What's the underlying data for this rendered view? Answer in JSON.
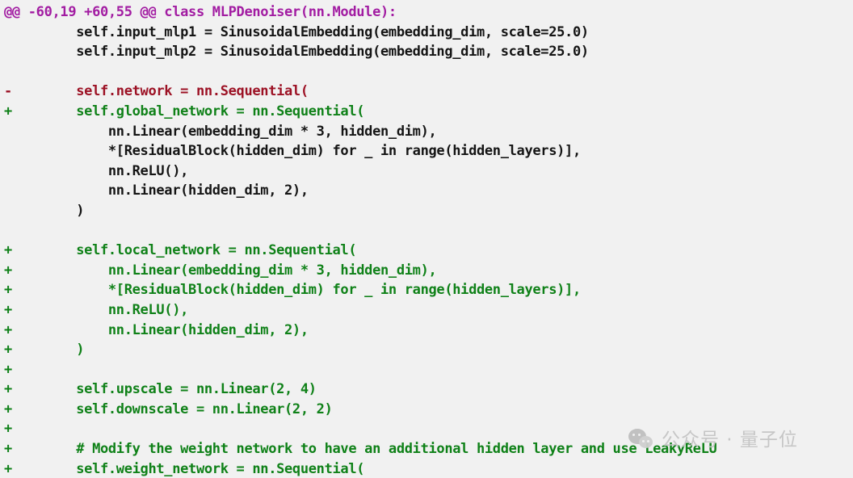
{
  "viewer": {
    "kind": "unified-diff",
    "background_color": "#f1f1f1",
    "colors": {
      "hunk_header": "#a21ca2",
      "context": "#141414",
      "deletion": "#9c1124",
      "addition": "#0f8118",
      "watermark": "#c4c4c4"
    }
  },
  "hunk": {
    "header": "@@ -60,19 +60,55 @@ class MLPDenoiser(nn.Module):",
    "old_start": 60,
    "old_count": 19,
    "new_start": 60,
    "new_count": 55,
    "section_heading": "class MLPDenoiser(nn.Module):"
  },
  "lines": [
    {
      "type": "hunk",
      "marker": "",
      "text": "@@ -60,19 +60,55 @@ class MLPDenoiser(nn.Module):"
    },
    {
      "type": "context",
      "marker": "",
      "text": "        self.input_mlp1 = SinusoidalEmbedding(embedding_dim, scale=25.0)"
    },
    {
      "type": "context",
      "marker": "",
      "text": "        self.input_mlp2 = SinusoidalEmbedding(embedding_dim, scale=25.0)"
    },
    {
      "type": "context",
      "marker": "",
      "text": ""
    },
    {
      "type": "delete",
      "marker": "-",
      "text": "        self.network = nn.Sequential("
    },
    {
      "type": "add",
      "marker": "+",
      "text": "        self.global_network = nn.Sequential("
    },
    {
      "type": "context",
      "marker": "",
      "text": "            nn.Linear(embedding_dim * 3, hidden_dim),"
    },
    {
      "type": "context",
      "marker": "",
      "text": "            *[ResidualBlock(hidden_dim) for _ in range(hidden_layers)],"
    },
    {
      "type": "context",
      "marker": "",
      "text": "            nn.ReLU(),"
    },
    {
      "type": "context",
      "marker": "",
      "text": "            nn.Linear(hidden_dim, 2),"
    },
    {
      "type": "context",
      "marker": "",
      "text": "        )"
    },
    {
      "type": "context",
      "marker": "",
      "text": ""
    },
    {
      "type": "add",
      "marker": "+",
      "text": "        self.local_network = nn.Sequential("
    },
    {
      "type": "add",
      "marker": "+",
      "text": "            nn.Linear(embedding_dim * 3, hidden_dim),"
    },
    {
      "type": "add",
      "marker": "+",
      "text": "            *[ResidualBlock(hidden_dim) for _ in range(hidden_layers)],"
    },
    {
      "type": "add",
      "marker": "+",
      "text": "            nn.ReLU(),"
    },
    {
      "type": "add",
      "marker": "+",
      "text": "            nn.Linear(hidden_dim, 2),"
    },
    {
      "type": "add",
      "marker": "+",
      "text": "        )"
    },
    {
      "type": "add",
      "marker": "+",
      "text": ""
    },
    {
      "type": "add",
      "marker": "+",
      "text": "        self.upscale = nn.Linear(2, 4)"
    },
    {
      "type": "add",
      "marker": "+",
      "text": "        self.downscale = nn.Linear(2, 2)"
    },
    {
      "type": "add",
      "marker": "+",
      "text": ""
    },
    {
      "type": "add",
      "marker": "+",
      "text": "        # Modify the weight network to have an additional hidden layer and use LeakyReLU"
    },
    {
      "type": "add",
      "marker": "+",
      "text": "        self.weight_network = nn.Sequential("
    }
  ],
  "watermark": {
    "text": "公众号 · 量子位",
    "logo": "wechat-bubbles-icon"
  }
}
